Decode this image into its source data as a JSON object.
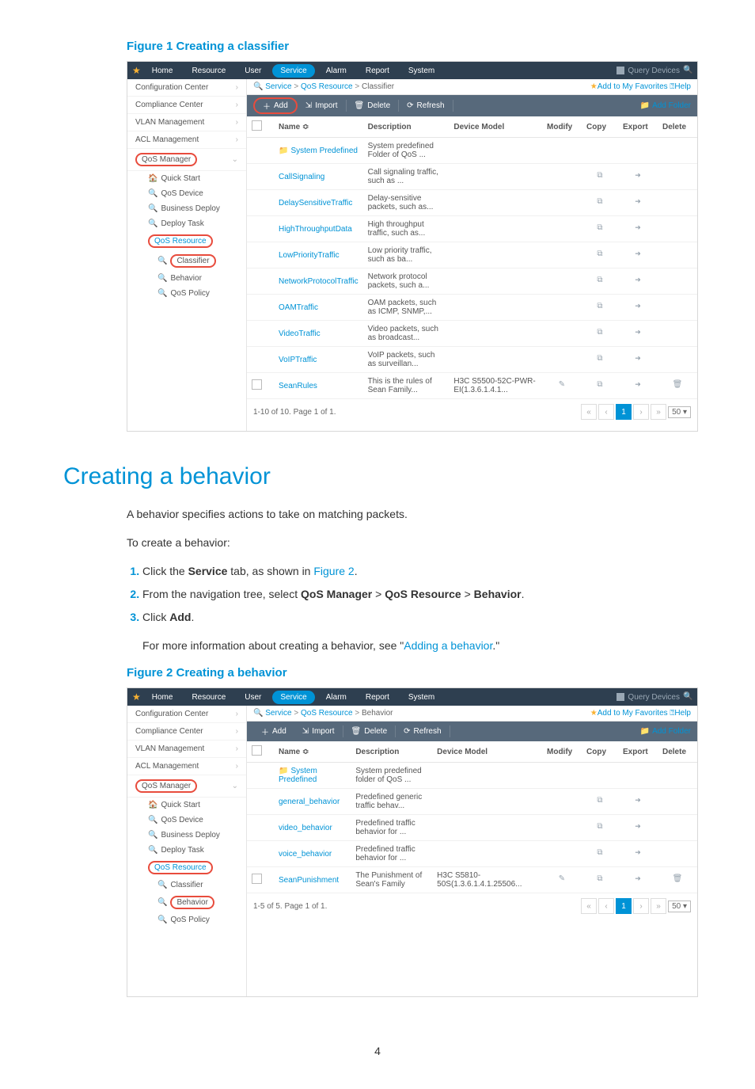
{
  "figure1": {
    "caption": "Figure 1 Creating a classifier",
    "nav": [
      "Home",
      "Resource",
      "User",
      "Service",
      "Alarm",
      "Report",
      "System"
    ],
    "nav_active": "Service",
    "query_devices": "Query Devices",
    "sidebar": {
      "items": [
        {
          "label": "Configuration Center",
          "chev": true
        },
        {
          "label": "Compliance Center",
          "chev": true
        },
        {
          "label": "VLAN Management",
          "chev": true
        },
        {
          "label": "ACL Management",
          "chev": true
        }
      ],
      "qos_manager": "QoS Manager",
      "subs": [
        {
          "icon": "🏠",
          "label": "Quick Start"
        },
        {
          "icon": "🔍",
          "label": "QoS Device"
        },
        {
          "icon": "🔍",
          "label": "Business Deploy"
        },
        {
          "icon": "🔍",
          "label": "Deploy Task"
        }
      ],
      "qos_resource": "QoS Resource",
      "leaf": [
        {
          "icon": "🔍",
          "label": "Classifier",
          "circled": true
        },
        {
          "icon": "🔍",
          "label": "Behavior"
        },
        {
          "icon": "🔍",
          "label": "QoS Policy"
        }
      ]
    },
    "breadcrumb": [
      "Service",
      "QoS Resource",
      "Classifier"
    ],
    "fav": "Add to My Favorites",
    "help": "Help",
    "toolbar": {
      "add": "Add",
      "import": "Import",
      "delete": "Delete",
      "refresh": "Refresh",
      "addfolder": "Add Folder"
    },
    "columns": [
      "",
      "Name ≎",
      "Description",
      "Device Model",
      "Modify",
      "Copy",
      "Export",
      "Delete"
    ],
    "rows": [
      {
        "name": "System Predefined",
        "desc": "System predefined Folder of QoS ...",
        "folder": true
      },
      {
        "name": "CallSignaling",
        "desc": "Call signaling traffic, such as ...",
        "copy": true,
        "export": true
      },
      {
        "name": "DelaySensitiveTraffic",
        "desc": "Delay-sensitive packets, such as...",
        "copy": true,
        "export": true
      },
      {
        "name": "HighThroughputData",
        "desc": "High throughput traffic, such as...",
        "copy": true,
        "export": true
      },
      {
        "name": "LowPriorityTraffic",
        "desc": "Low priority traffic, such as ba...",
        "copy": true,
        "export": true
      },
      {
        "name": "NetworkProtocolTraffic",
        "desc": "Network protocol packets, such a...",
        "copy": true,
        "export": true
      },
      {
        "name": "OAMTraffic",
        "desc": "OAM packets, such as ICMP, SNMP,...",
        "copy": true,
        "export": true
      },
      {
        "name": "VideoTraffic",
        "desc": "Video packets, such as broadcast...",
        "copy": true,
        "export": true
      },
      {
        "name": "VoIPTraffic",
        "desc": "VoIP packets, such as surveillan...",
        "copy": true,
        "export": true
      },
      {
        "name": "SeanRules",
        "desc": "This is the rules of Sean Family...",
        "model": "H3C S5500-52C-PWR-EI(1.3.6.1.4.1...",
        "modify": true,
        "copy": true,
        "export": true,
        "del": true,
        "check": true
      }
    ],
    "pager": {
      "info": "1-10 of 10. Page 1 of 1.",
      "page": "1",
      "per": "50"
    }
  },
  "section": {
    "title": "Creating a behavior",
    "intro": "A behavior specifies actions to take on matching packets.",
    "lead": "To create a behavior:",
    "steps": [
      {
        "pre": "Click the ",
        "b1": "Service",
        "mid": " tab, as shown in ",
        "link": "Figure 2",
        "post": "."
      },
      {
        "pre": "From the navigation tree, select ",
        "b1": "QoS Manager",
        "sep1": " > ",
        "b2": "QoS Resource",
        "sep2": " > ",
        "b3": "Behavior",
        "post": "."
      },
      {
        "pre": "Click ",
        "b1": "Add",
        "post": "."
      }
    ],
    "more_pre": "For more information about creating a behavior, see \"",
    "more_link": "Adding a behavior",
    "more_post": ".\""
  },
  "figure2": {
    "caption": "Figure 2 Creating a behavior",
    "nav": [
      "Home",
      "Resource",
      "User",
      "Service",
      "Alarm",
      "Report",
      "System"
    ],
    "nav_active": "Service",
    "query_devices": "Query Devices",
    "sidebar": {
      "items": [
        {
          "label": "Configuration Center",
          "chev": true
        },
        {
          "label": "Compliance Center",
          "chev": true
        },
        {
          "label": "VLAN Management",
          "chev": true
        },
        {
          "label": "ACL Management",
          "chev": true
        }
      ],
      "qos_manager": "QoS Manager",
      "subs": [
        {
          "icon": "🏠",
          "label": "Quick Start"
        },
        {
          "icon": "🔍",
          "label": "QoS Device"
        },
        {
          "icon": "🔍",
          "label": "Business Deploy"
        },
        {
          "icon": "🔍",
          "label": "Deploy Task"
        }
      ],
      "qos_resource": "QoS Resource",
      "leaf": [
        {
          "icon": "🔍",
          "label": "Classifier"
        },
        {
          "icon": "🔍",
          "label": "Behavior",
          "circled": true
        },
        {
          "icon": "🔍",
          "label": "QoS Policy"
        }
      ]
    },
    "breadcrumb": [
      "Service",
      "QoS Resource",
      "Behavior"
    ],
    "fav": "Add to My Favorites",
    "help": "Help",
    "toolbar": {
      "add": "Add",
      "import": "Import",
      "delete": "Delete",
      "refresh": "Refresh",
      "addfolder": "Add Folder"
    },
    "columns": [
      "",
      "Name ≎",
      "Description",
      "Device Model",
      "Modify",
      "Copy",
      "Export",
      "Delete"
    ],
    "rows": [
      {
        "name": "System Predefined",
        "desc": "System predefined folder of QoS ...",
        "folder": true
      },
      {
        "name": "general_behavior",
        "desc": "Predefined generic traffic behav...",
        "copy": true,
        "export": true
      },
      {
        "name": "video_behavior",
        "desc": "Predefined traffic behavior for ...",
        "copy": true,
        "export": true
      },
      {
        "name": "voice_behavior",
        "desc": "Predefined traffic behavior for ...",
        "copy": true,
        "export": true
      },
      {
        "name": "SeanPunishment",
        "desc": "The Punishment of Sean's Family",
        "model": "H3C S5810-50S(1.3.6.1.4.1.25506...",
        "modify": true,
        "copy": true,
        "export": true,
        "del": true,
        "check": true
      }
    ],
    "pager": {
      "info": "1-5 of 5. Page 1 of 1.",
      "page": "1",
      "per": "50"
    }
  },
  "page_number": "4"
}
